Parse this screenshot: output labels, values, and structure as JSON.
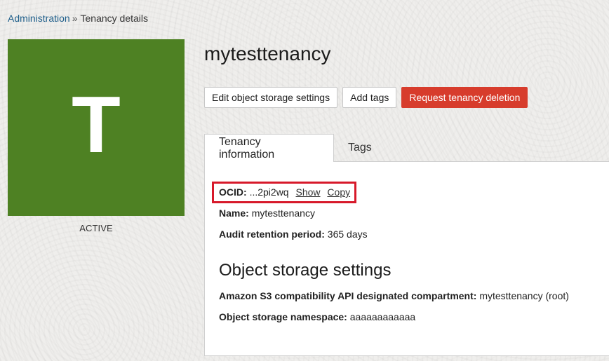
{
  "breadcrumb": {
    "parent": "Administration",
    "separator": "»",
    "current": "Tenancy details"
  },
  "avatar": {
    "letter": "T",
    "color": "#4e8123"
  },
  "status": "ACTIVE",
  "title": "mytesttenancy",
  "actions": {
    "edit_storage": "Edit object storage settings",
    "add_tags": "Add tags",
    "request_deletion": "Request tenancy deletion",
    "danger_color": "#d73c2c"
  },
  "tabs": {
    "info": "Tenancy information",
    "tags": "Tags"
  },
  "info": {
    "ocid_label": "OCID:",
    "ocid_value": "...2pi2wq",
    "show": "Show",
    "copy": "Copy",
    "name_label": "Name:",
    "name_value": "mytesttenancy",
    "audit_label": "Audit retention period:",
    "audit_value": "365 days"
  },
  "storage": {
    "title": "Object storage settings",
    "s3_label": "Amazon S3 compatibility API designated compartment:",
    "s3_value": "mytesttenancy (root)",
    "namespace_label": "Object storage namespace:",
    "namespace_value": "aaaaaaaaaaaa"
  },
  "highlight_color": "#d7192a"
}
